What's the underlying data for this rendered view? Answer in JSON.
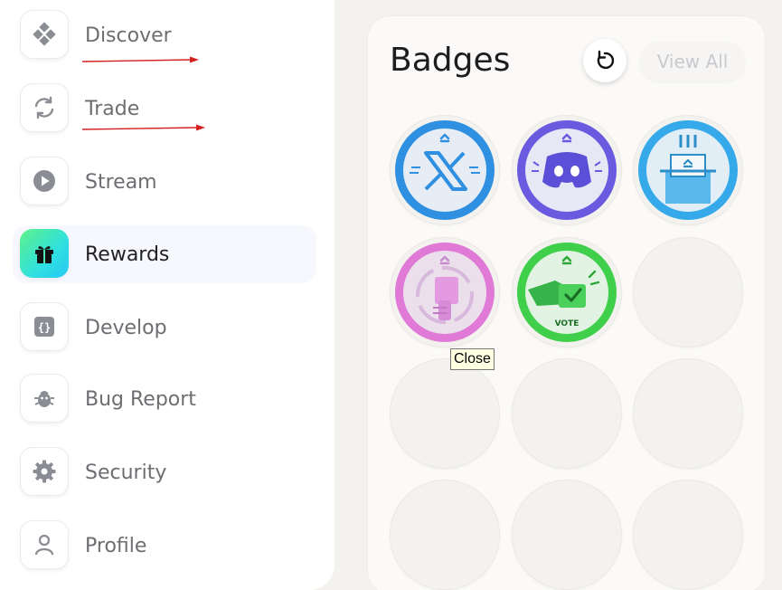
{
  "sidebar": {
    "items": [
      {
        "label": "Discover",
        "icon": "diamond-grid-icon",
        "active": false
      },
      {
        "label": "Trade",
        "icon": "refresh-arrows-icon",
        "active": false
      },
      {
        "label": "Stream",
        "icon": "play-circle-icon",
        "active": false
      },
      {
        "label": "Rewards",
        "icon": "gift-icon",
        "active": true
      },
      {
        "label": "Develop",
        "icon": "braces-icon",
        "active": false
      },
      {
        "label": "Bug Report",
        "icon": "bug-icon",
        "active": false
      },
      {
        "label": "Security",
        "icon": "gear-icon",
        "active": false
      },
      {
        "label": "Profile",
        "icon": "user-icon",
        "active": false
      }
    ]
  },
  "badges": {
    "title": "Badges",
    "view_all_label": "View All",
    "refresh_icon": "refresh-icon",
    "earned": [
      {
        "name": "x-badge",
        "ring": "#2f8fe0"
      },
      {
        "name": "discord-badge",
        "ring": "#6a5ae0"
      },
      {
        "name": "ballot-box-badge",
        "ring": "#35a9ea"
      },
      {
        "name": "hand-badge",
        "ring": "#e07ad6"
      },
      {
        "name": "vote-badge",
        "ring": "#3fcf4a",
        "text": "VOTE"
      }
    ],
    "empty_slots": 7
  },
  "tooltip": {
    "text": "Close"
  },
  "colors": {
    "accent_gradient_start": "#5ff28a",
    "accent_gradient_end": "#28c8f5",
    "annotation_arrow": "#d42020"
  }
}
